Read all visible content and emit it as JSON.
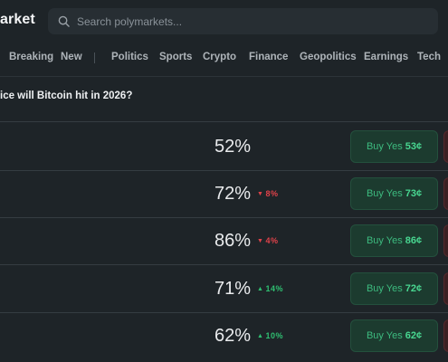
{
  "app": {
    "logo_text": "arket"
  },
  "search": {
    "placeholder": "Search polymarkets..."
  },
  "nav": {
    "items": [
      {
        "label": "Breaking"
      },
      {
        "label": "New"
      },
      {
        "label": "Politics"
      },
      {
        "label": "Sports"
      },
      {
        "label": "Crypto"
      },
      {
        "label": "Finance"
      },
      {
        "label": "Geopolitics"
      },
      {
        "label": "Earnings"
      },
      {
        "label": "Tech"
      }
    ]
  },
  "market": {
    "question": "ice will Bitcoin hit in 2026?"
  },
  "outcomes": [
    {
      "percent": "52%",
      "change": "",
      "direction": "",
      "buy_yes_label": "Buy Yes",
      "buy_yes_price": "53¢"
    },
    {
      "percent": "72%",
      "change": "8%",
      "direction": "down",
      "buy_yes_label": "Buy Yes",
      "buy_yes_price": "73¢"
    },
    {
      "percent": "86%",
      "change": "4%",
      "direction": "down",
      "buy_yes_label": "Buy Yes",
      "buy_yes_price": "86¢"
    },
    {
      "percent": "71%",
      "change": "14%",
      "direction": "up",
      "buy_yes_label": "Buy Yes",
      "buy_yes_price": "72¢"
    },
    {
      "percent": "62%",
      "change": "10%",
      "direction": "up",
      "buy_yes_label": "Buy Yes",
      "buy_yes_price": "62¢"
    }
  ],
  "colors": {
    "background": "#1e2428",
    "yes_green": "#48d690",
    "down_red": "#e0424a",
    "up_green": "#2fbf71"
  }
}
